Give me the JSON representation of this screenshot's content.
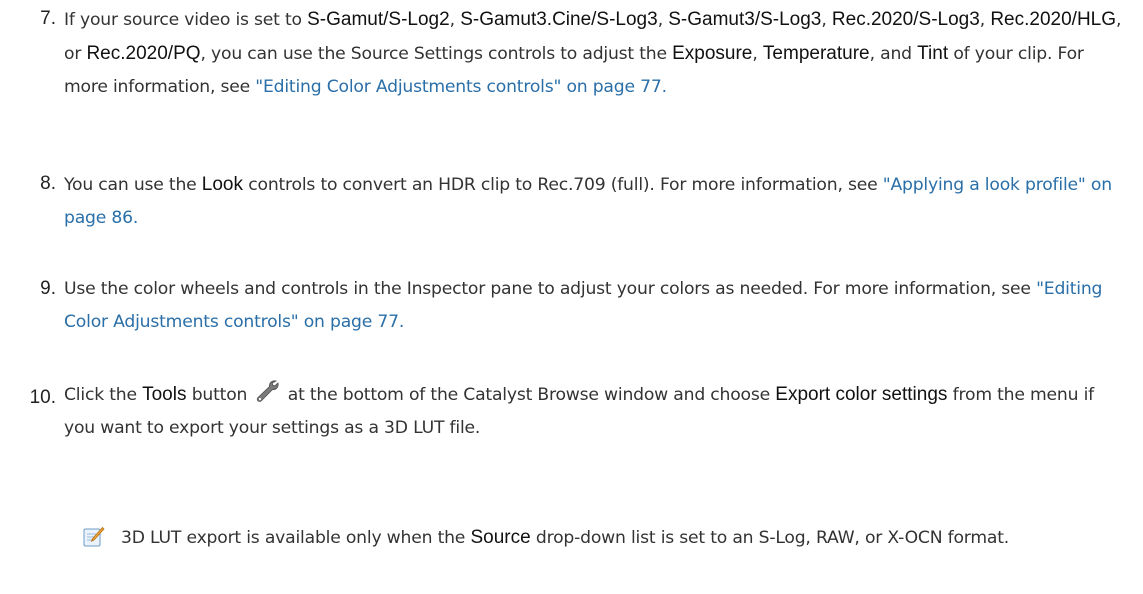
{
  "steps": [
    {
      "number": "7.",
      "parts": {
        "t1": "If your source video is set to ",
        "s1": "S-Gamut/S-Log2",
        "t2": ", ",
        "s2": "S-Gamut3.Cine/S-Log3",
        "t3": ", ",
        "s3": "S-Gamut3/S-Log3",
        "t4": ", ",
        "s4": "Rec.2020/S-Log3",
        "t5": ", ",
        "s5": "Rec.2020/HLG",
        "t6": ", or ",
        "s6": "Rec.2020/PQ",
        "t7": ", you can use the Source Settings controls to adjust the ",
        "u1": "Exposure",
        "t8": ", ",
        "u2": "Temperature",
        "t9": ", and ",
        "u3": "Tint",
        "t10": " of your clip. For more information, see ",
        "link": "\"Editing Color Adjustments controls\" on page 77."
      }
    },
    {
      "number": "8.",
      "parts": {
        "t1": "You can use the ",
        "u1": "Look",
        "t2": " controls to convert an HDR clip to Rec.709 (full). For more information, see ",
        "link": "\"Applying a look profile\" on page 86."
      }
    },
    {
      "number": "9.",
      "parts": {
        "t1": "Use the color wheels and controls in the Inspector pane to adjust your colors as needed. For more information, see ",
        "link": "\"Editing Color Adjustments controls\" on page 77."
      }
    },
    {
      "number": "10.",
      "parts": {
        "t1": "Click the ",
        "u1": "Tools",
        "t2": " button ",
        "icon": "wrench-icon",
        "t3": " at the bottom of the Catalyst Browse window and choose ",
        "u2": "Export color settings",
        "t4": " from the menu if you want to export your settings as a 3D LUT file."
      }
    }
  ],
  "note": {
    "icon": "note-pencil-icon",
    "t1": "3D LUT export is available only when the ",
    "u1": "Source",
    "t2": " drop-down list is set to an S-Log, RAW, or X-OCN format."
  },
  "colors": {
    "link": "#2a6fa8",
    "text": "#333333",
    "ui_text": "#111111"
  }
}
